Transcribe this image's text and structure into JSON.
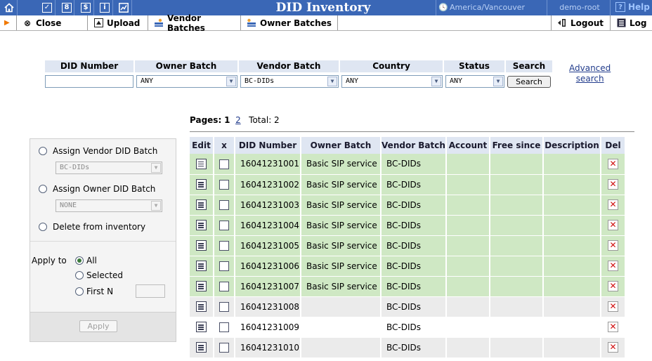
{
  "app": {
    "title": "DID Inventory",
    "timezone": "America/Vancouver",
    "user": "demo-root",
    "help_label": "Help"
  },
  "toolbar": {
    "close_label": "Close",
    "upload_label": "Upload",
    "vendor_batches_label": "Vendor Batches",
    "owner_batches_label": "Owner Batches",
    "logout_label": "Logout",
    "log_label": "Log"
  },
  "search": {
    "headers": {
      "did_number": "DID Number",
      "owner_batch": "Owner Batch",
      "vendor_batch": "Vendor Batch",
      "country": "Country",
      "status": "Status",
      "search": "Search"
    },
    "did_number_value": "",
    "owner_batch_value": "ANY",
    "vendor_batch_value": "BC-DIDs",
    "country_value": "ANY",
    "status_value": "ANY",
    "search_button": "Search",
    "advanced_line1": "Advanced",
    "advanced_line2": "search"
  },
  "pager": {
    "pages_label": "Pages:",
    "current_page": "1",
    "other_page": "2",
    "total_label": "Total: 2"
  },
  "actions": {
    "assign_vendor_label": "Assign Vendor DID Batch",
    "assign_vendor_value": "BC-DIDs",
    "assign_owner_label": "Assign Owner DID Batch",
    "assign_owner_value": "NONE",
    "delete_label": "Delete from inventory",
    "apply_to_label": "Apply to",
    "all_label": "All",
    "selected_label": "Selected",
    "first_n_label": "First N",
    "apply_button": "Apply"
  },
  "table": {
    "columns": [
      "Edit",
      "x",
      "DID Number",
      "Owner Batch",
      "Vendor Batch",
      "Account",
      "Free since",
      "Description",
      "Del"
    ],
    "rows": [
      {
        "did": "16041231001",
        "owner": "Basic SIP service",
        "vendor": "BC-DIDs",
        "account": "",
        "free_since": "",
        "description": "",
        "style": "green"
      },
      {
        "did": "16041231002",
        "owner": "Basic SIP service",
        "vendor": "BC-DIDs",
        "account": "",
        "free_since": "",
        "description": "",
        "style": "green"
      },
      {
        "did": "16041231003",
        "owner": "Basic SIP service",
        "vendor": "BC-DIDs",
        "account": "",
        "free_since": "",
        "description": "",
        "style": "green"
      },
      {
        "did": "16041231004",
        "owner": "Basic SIP service",
        "vendor": "BC-DIDs",
        "account": "",
        "free_since": "",
        "description": "",
        "style": "green"
      },
      {
        "did": "16041231005",
        "owner": "Basic SIP service",
        "vendor": "BC-DIDs",
        "account": "",
        "free_since": "",
        "description": "",
        "style": "green"
      },
      {
        "did": "16041231006",
        "owner": "Basic SIP service",
        "vendor": "BC-DIDs",
        "account": "",
        "free_since": "",
        "description": "",
        "style": "green"
      },
      {
        "did": "16041231007",
        "owner": "Basic SIP service",
        "vendor": "BC-DIDs",
        "account": "",
        "free_since": "",
        "description": "",
        "style": "green"
      },
      {
        "did": "16041231008",
        "owner": "",
        "vendor": "BC-DIDs",
        "account": "",
        "free_since": "",
        "description": "",
        "style": "grey"
      },
      {
        "did": "16041231009",
        "owner": "",
        "vendor": "BC-DIDs",
        "account": "",
        "free_since": "",
        "description": "",
        "style": "white"
      },
      {
        "did": "16041231010",
        "owner": "",
        "vendor": "BC-DIDs",
        "account": "",
        "free_since": "",
        "description": "",
        "style": "grey"
      }
    ]
  },
  "colors": {
    "title_bar": "#3a67b6",
    "header_bg": "#dfe6f2",
    "row_assigned": "#cfe8c4",
    "row_free": "#ebebeb"
  }
}
